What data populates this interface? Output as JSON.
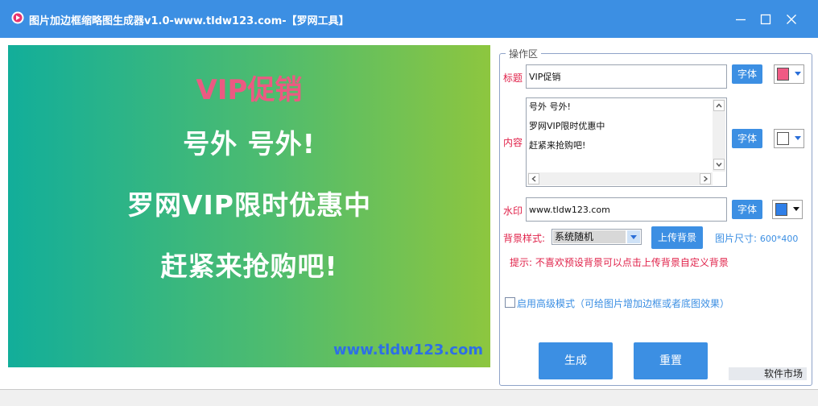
{
  "window": {
    "title": "图片加边框缩略图生成器v1.0-www.tldw123.com-【罗网工具】",
    "colors": {
      "titlebar": "#3c8fe3",
      "accent": "#3c8fe3",
      "label_red": "#e0224a"
    }
  },
  "preview": {
    "title": "VIP促销",
    "lines": [
      "号外 号外!",
      "罗网VIP限时优惠中",
      "赶紧来抢购吧!"
    ],
    "watermark": "www.tldw123.com",
    "colors": {
      "title": "#ec5a82",
      "text": "#ffffff",
      "watermark": "#2d6fe6",
      "gradient_start": "#12ae9a",
      "gradient_end": "#8dc63f"
    }
  },
  "panel": {
    "legend": "操作区",
    "title_label": "标题",
    "title_value": "VIP促销",
    "content_label": "内容",
    "content_lines": [
      "号外 号外!",
      "罗网VIP限时优惠中",
      "赶紧来抢购吧!"
    ],
    "watermark_label": "水印",
    "watermark_value": "www.tldw123.com",
    "font_button": "字体",
    "title_color": "#f05a84",
    "content_color": "#ffffff",
    "watermark_color": "#2f7fe8",
    "bg_style_label": "背景样式:",
    "bg_style_value": "系统随机",
    "upload_button": "上传背景",
    "size_label": "图片尺寸:",
    "size_value": "600*400",
    "hint": "提示: 不喜欢预设背景可以点击上传背景自定义背景",
    "advanced_label": "启用高级模式（可给图片增加边框或者底图效果）",
    "advanced_checked": false,
    "generate_button": "生成",
    "reset_button": "重置",
    "market_label": "软件市场"
  }
}
